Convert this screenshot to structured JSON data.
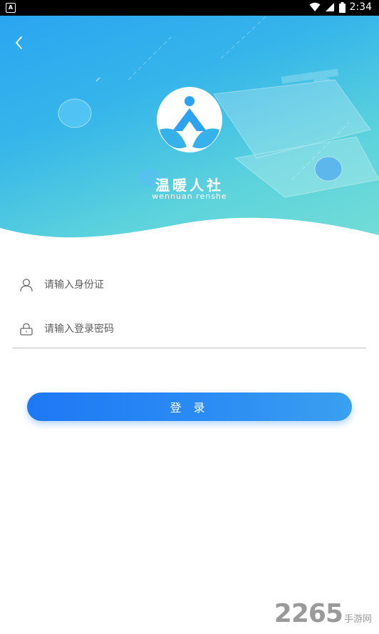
{
  "status_bar": {
    "time": "2:34",
    "app_indicator": "A"
  },
  "header": {
    "back_icon": "chevron-left-icon"
  },
  "brand": {
    "name_cn": "温暖人社",
    "name_en": "wennuan renshe"
  },
  "form": {
    "id_field": {
      "placeholder": "请输入身份证",
      "value": "",
      "icon": "user-icon"
    },
    "password_field": {
      "placeholder": "请输入登录密码",
      "value": "",
      "icon": "lock-icon"
    },
    "login_label": "登 录"
  },
  "watermark": {
    "number": "2265",
    "suffix": "手游网"
  },
  "colors": {
    "primary": "#1e78f5",
    "hero_start": "#2aa5f1",
    "hero_end": "#74ddd6"
  }
}
